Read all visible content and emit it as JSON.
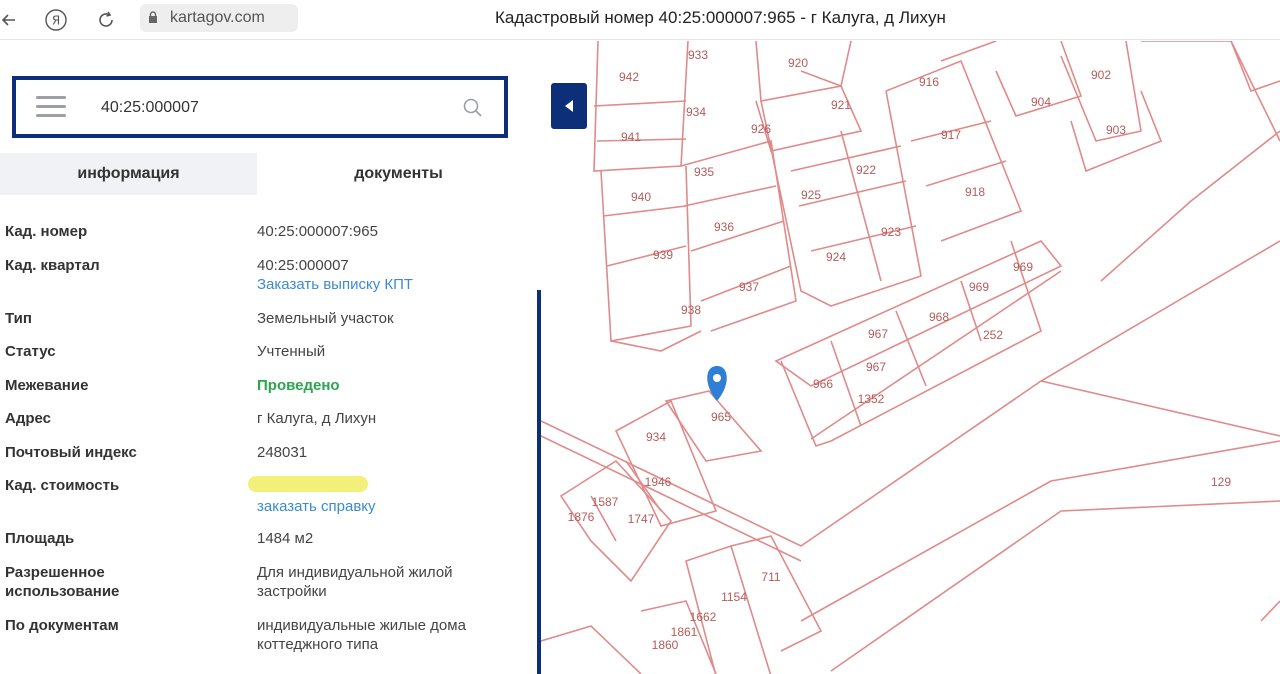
{
  "browser": {
    "url": "kartagov.com",
    "page_title": "Кадастровый номер 40:25:000007:965 - г Калуга, д Лихун"
  },
  "search": {
    "value": "40:25:000007"
  },
  "tabs": [
    {
      "label": "информация"
    },
    {
      "label": "документы"
    }
  ],
  "info": {
    "rows": [
      {
        "label": "Кад. номер",
        "value": "40:25:000007:965"
      },
      {
        "label": "Кад. квартал",
        "value": "40:25:000007",
        "link": "Заказать выписку КПТ"
      },
      {
        "label": "Тип",
        "value": "Земельный участок"
      },
      {
        "label": "Статус",
        "value": "Учтенный"
      },
      {
        "label": "Межевание",
        "value": "Проведено"
      },
      {
        "label": "Адрес",
        "value": "г Калуга, д Лихун"
      },
      {
        "label": "Почтовый индекс",
        "value": "248031"
      },
      {
        "label": "Кад. стоимость",
        "link": "заказать справку"
      },
      {
        "label": "Площадь",
        "value": "1484 м2"
      },
      {
        "label": "Разрешенное использование",
        "value": "Для индивидуальной жилой застройки"
      },
      {
        "label": "По документам",
        "value": "индивидуальные жилые дома коттеджного типа"
      }
    ]
  },
  "map": {
    "parcels": [
      "942",
      "933",
      "920",
      "941",
      "934",
      "926",
      "921",
      "916",
      "904",
      "902",
      "903",
      "935",
      "917",
      "940",
      "925",
      "922",
      "918",
      "936",
      "923",
      "939",
      "924",
      "937",
      "938",
      "969",
      "969",
      "968",
      "967",
      "967",
      "966",
      "252",
      "1352",
      "965",
      "934",
      "1946",
      "1876",
      "1587",
      "1747",
      "1154",
      "711",
      "1662",
      "1861",
      "1860",
      "129"
    ],
    "colors": {
      "parcel_line": "#e08a8a",
      "parcel_label": "#b55b5b",
      "marker": "#2f7fd6",
      "accent": "#0d2f7a"
    }
  }
}
